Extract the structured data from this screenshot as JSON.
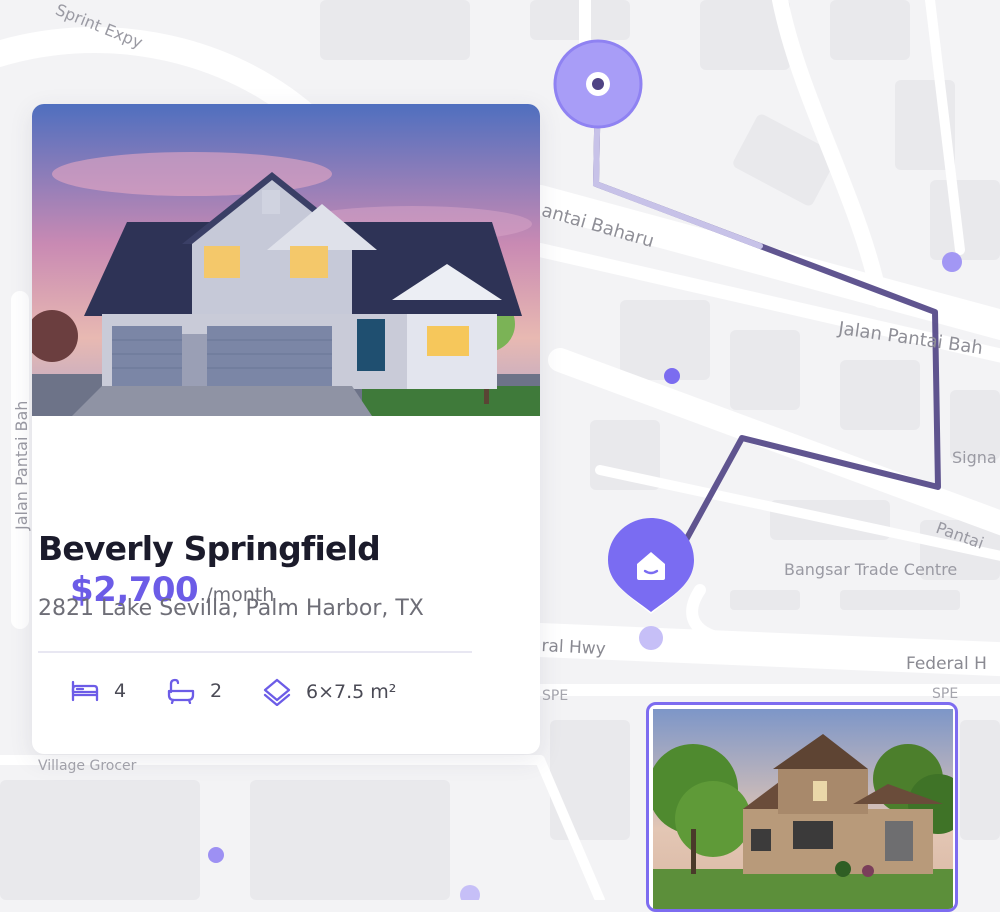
{
  "map": {
    "labels": {
      "sprint": "Sprint Expy",
      "pantai_baharu": "antai Baharu",
      "jalan_pantai_bah": "Jalan Pantai Bah",
      "jalan_pantai_left": "Jalan Pantai Bah",
      "signa": "Signa",
      "pantai_right": "Pantai",
      "bangsar": "Bangsar Trade Centre",
      "federal_hwy_left": "ral Hwy",
      "federal_right": "Federal H",
      "spe_left": "SPE",
      "spe_right": "SPE",
      "village_grocer": "Village Grocer"
    }
  },
  "listing": {
    "price": "$2,700",
    "period": "/month",
    "title": "Beverly Springfield",
    "address": "2821 Lake Sevilla, Palm Harbor, TX",
    "bedrooms": "4",
    "bathrooms": "2",
    "area": "6×7.5 m²"
  },
  "icons": {
    "bed": "bed-icon",
    "bath": "bathtub-icon",
    "area": "area-icon",
    "home_pin": "home-pin-icon",
    "origin": "location-origin-icon"
  },
  "colors": {
    "accent": "#6c5ce7",
    "route": "#4f4384",
    "marker": "#8f82f2"
  }
}
